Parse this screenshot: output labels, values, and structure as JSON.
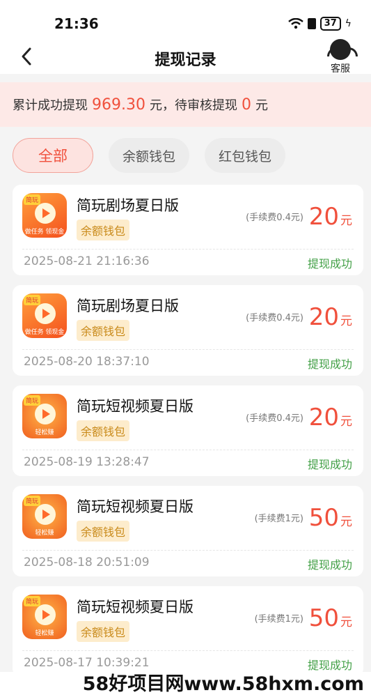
{
  "status_bar": {
    "time": "21:36",
    "battery": "37"
  },
  "header": {
    "title": "提现记录",
    "service_label": "客服"
  },
  "summary": {
    "prefix": "累计成功提现",
    "total": "969.30",
    "mid": "元，待审核提现",
    "pending": "0",
    "suffix": "元"
  },
  "filters": [
    {
      "label": "全部",
      "active": true
    },
    {
      "label": "余额钱包",
      "active": false
    },
    {
      "label": "红包钱包",
      "active": false
    }
  ],
  "records": [
    {
      "app": "简玩剧场夏日版",
      "wallet": "余额钱包",
      "fee": "(手续费0.4元)",
      "amount": "20",
      "unit": "元",
      "date": "2025-08-21 21:16:36",
      "status": "提现成功",
      "icon": "drama"
    },
    {
      "app": "简玩剧场夏日版",
      "wallet": "余额钱包",
      "fee": "(手续费0.4元)",
      "amount": "20",
      "unit": "元",
      "date": "2025-08-20 18:37:10",
      "status": "提现成功",
      "icon": "drama"
    },
    {
      "app": "简玩短视频夏日版",
      "wallet": "余额钱包",
      "fee": "(手续费0.4元)",
      "amount": "20",
      "unit": "元",
      "date": "2025-08-19 13:28:47",
      "status": "提现成功",
      "icon": "video"
    },
    {
      "app": "简玩短视频夏日版",
      "wallet": "余额钱包",
      "fee": "(手续费1元)",
      "amount": "50",
      "unit": "元",
      "date": "2025-08-18 20:51:09",
      "status": "提现成功",
      "icon": "video"
    },
    {
      "app": "简玩短视频夏日版",
      "wallet": "余额钱包",
      "fee": "(手续费1元)",
      "amount": "50",
      "unit": "元",
      "date": "2025-08-17 10:39:21",
      "status": "提现成功",
      "icon": "video"
    }
  ],
  "icon_text": {
    "tag": "简玩",
    "drama_caption": "做任务 领现金",
    "video_caption": "轻松赚"
  },
  "watermark": "58好项目网www.58hxm.com",
  "colors": {
    "accent": "#f0503c",
    "success": "#43a047",
    "summary_bg": "#fde9e7",
    "wallet_tag_bg": "#fdeccc"
  }
}
